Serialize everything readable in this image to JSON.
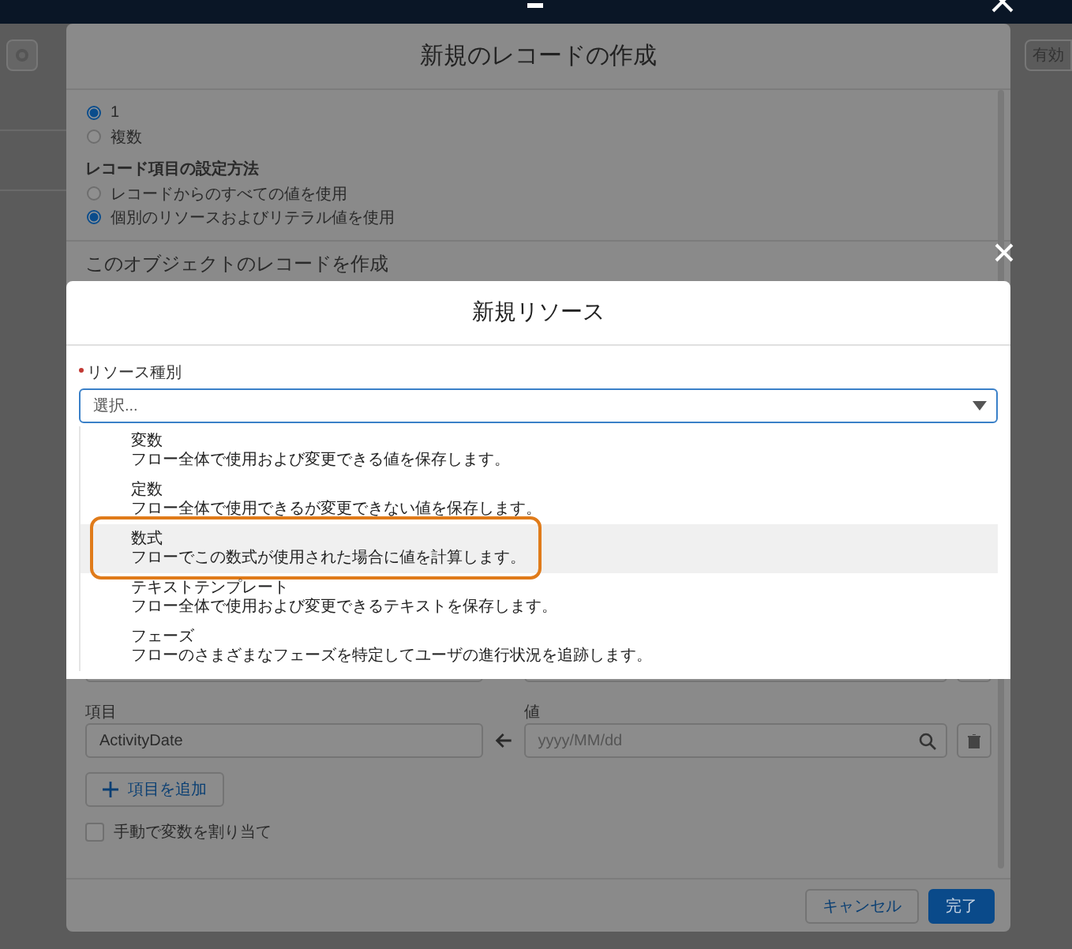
{
  "background": {
    "activate_button": "有効"
  },
  "record_modal": {
    "title": "新規のレコードの作成",
    "count_options": [
      {
        "label": "1",
        "selected": true
      },
      {
        "label": "複数",
        "selected": false
      }
    ],
    "field_method": {
      "label": "レコード項目の設定方法",
      "options": [
        {
          "label": "レコードからのすべての値を使用",
          "selected": false
        },
        {
          "label": "個別のリソースおよびリテラル値を使用",
          "selected": true
        }
      ]
    },
    "section_title": "このオブジェクトのレコードを作成",
    "assignments": [
      {
        "field_label": "項目",
        "field": "ActivityDate",
        "value_label": "値",
        "placeholder": "yyyy/MM/dd"
      }
    ],
    "add_button": "項目を追加",
    "manual_assign": {
      "label": "手動で変数を割り当て",
      "checked": false
    },
    "buttons": [
      {
        "label": "キャンセル",
        "kind": "neutral"
      },
      {
        "label": "完了",
        "kind": "brand"
      }
    ]
  },
  "resource_modal": {
    "title": "新規リソース",
    "field": {
      "label": "リソース種別",
      "required": true,
      "placeholder": "選択..."
    },
    "options": [
      {
        "title": "変数",
        "description": "フロー全体で使用および変更できる値を保存します。",
        "highlighted": false
      },
      {
        "title": "定数",
        "description": "フロー全体で使用できるが変更できない値を保存します。",
        "highlighted": false
      },
      {
        "title": "数式",
        "description": "フローでこの数式が使用された場合に値を計算します。",
        "highlighted": true
      },
      {
        "title": "テキストテンプレート",
        "description": "フロー全体で使用および変更できるテキストを保存します。",
        "highlighted": false
      },
      {
        "title": "フェーズ",
        "description": "フローのさまざまなフェーズを特定してユーザの進行状況を追跡します。",
        "highlighted": false
      }
    ]
  }
}
